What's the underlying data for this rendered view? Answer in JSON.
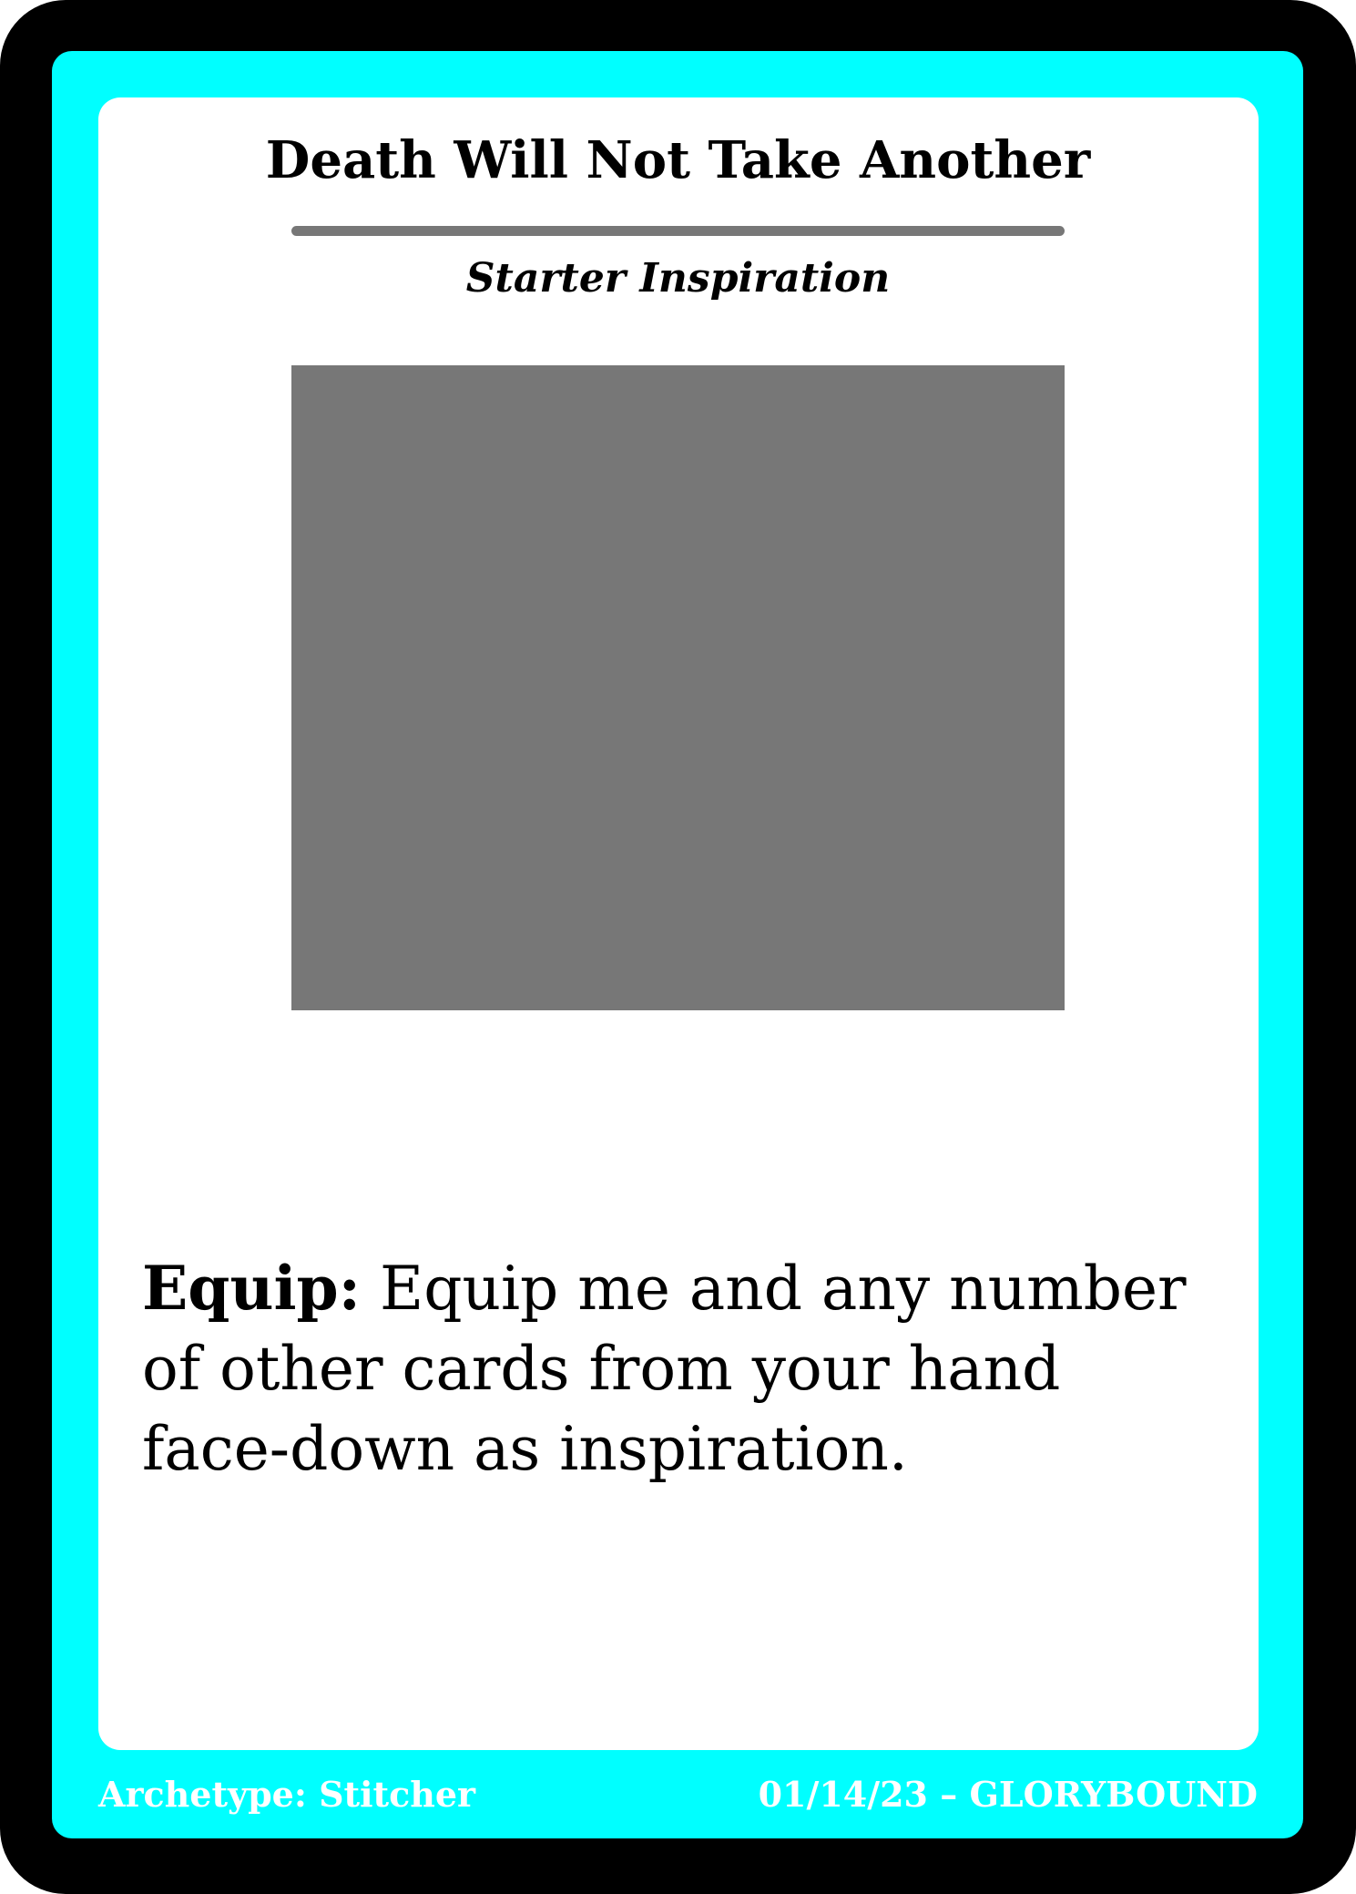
{
  "card": {
    "title": "Death Will Not Take Another",
    "type_line": "Starter Inspiration",
    "ability": {
      "keyword": "Equip:",
      "text": " Equip me and any number of other cards from your hand face-down as inspiration."
    },
    "footer": {
      "archetype": "Archetype: Stitcher",
      "date_and_set": "01/14/23 – GLORYBOUND"
    }
  },
  "colors": {
    "frame": "#00ffff",
    "border": "#000000",
    "art_placeholder": "#777777",
    "rule": "#777777"
  }
}
